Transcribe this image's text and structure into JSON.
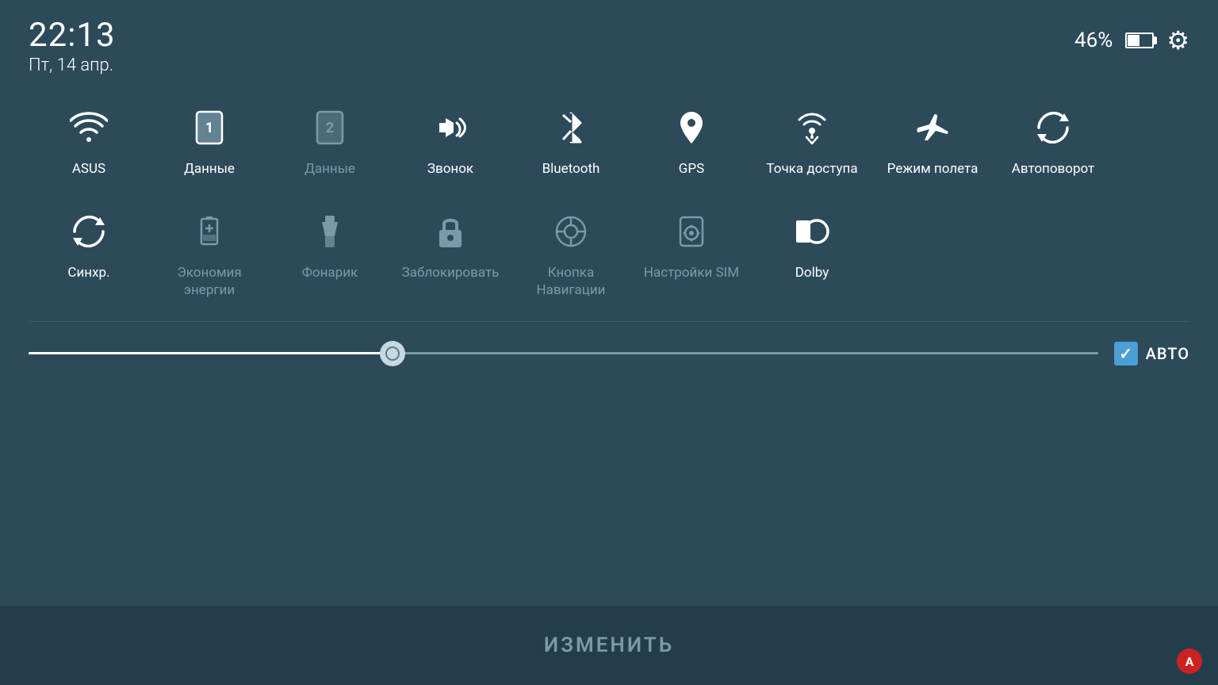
{
  "header": {
    "time": "22:13",
    "date": "Пт, 14 апр.",
    "battery_percent": "46%",
    "settings_label": "settings"
  },
  "row1_tiles": [
    {
      "id": "wifi",
      "label": "ASUS",
      "active": true,
      "icon": "wifi"
    },
    {
      "id": "data1",
      "label": "Данные",
      "active": true,
      "icon": "sim1"
    },
    {
      "id": "data2",
      "label": "Данные",
      "active": false,
      "icon": "sim2"
    },
    {
      "id": "sound",
      "label": "Звонок",
      "active": true,
      "icon": "sound"
    },
    {
      "id": "bluetooth",
      "label": "Bluetooth",
      "active": true,
      "icon": "bluetooth"
    },
    {
      "id": "gps",
      "label": "GPS",
      "active": true,
      "icon": "gps"
    },
    {
      "id": "hotspot",
      "label": "Точка доступа",
      "active": true,
      "icon": "hotspot"
    },
    {
      "id": "airplane",
      "label": "Режим полета",
      "active": true,
      "icon": "airplane"
    },
    {
      "id": "rotate",
      "label": "Автоповорот",
      "active": true,
      "icon": "rotate"
    }
  ],
  "row2_tiles": [
    {
      "id": "sync",
      "label": "Синхр.",
      "active": true,
      "icon": "sync"
    },
    {
      "id": "battery_save",
      "label": "Экономия энергии",
      "active": false,
      "icon": "battery_save"
    },
    {
      "id": "flashlight",
      "label": "Фонарик",
      "active": false,
      "icon": "flashlight"
    },
    {
      "id": "lock",
      "label": "Заблокировать",
      "active": false,
      "icon": "lock"
    },
    {
      "id": "nav",
      "label": "Кнопка Навигации",
      "active": false,
      "icon": "nav"
    },
    {
      "id": "sim_settings",
      "label": "Настройки SIM",
      "active": false,
      "icon": "sim_settings"
    },
    {
      "id": "dolby",
      "label": "Dolby",
      "active": true,
      "icon": "dolby"
    }
  ],
  "brightness": {
    "value": 34,
    "auto_label": "АВТО",
    "auto_checked": true
  },
  "bottom": {
    "change_label": "ИЗМЕНИТЬ"
  },
  "asus_logo": "A"
}
